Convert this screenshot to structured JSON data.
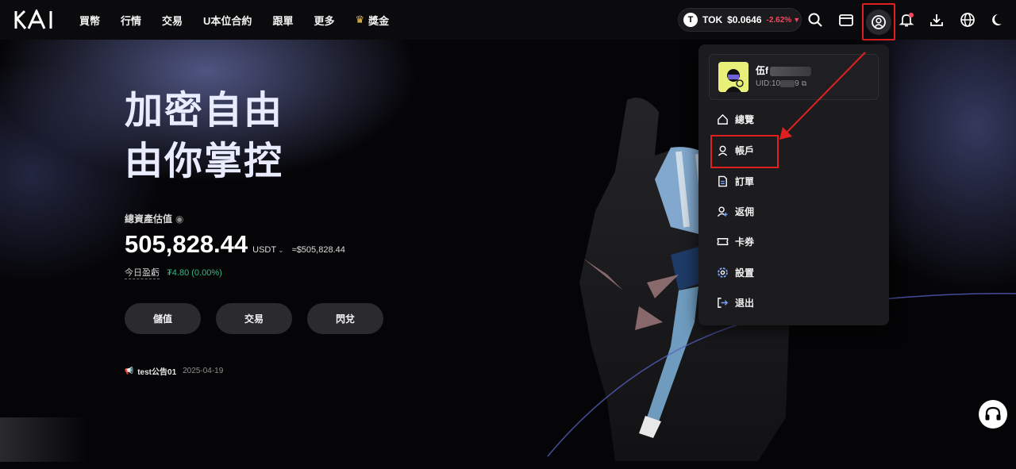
{
  "brand": {
    "logo_text": "KAI"
  },
  "nav": {
    "items": [
      {
        "label": "買幣"
      },
      {
        "label": "行情"
      },
      {
        "label": "交易"
      },
      {
        "label": "U本位合約"
      },
      {
        "label": "跟單"
      },
      {
        "label": "更多"
      },
      {
        "label": "獎金",
        "icon": "crown-icon"
      }
    ]
  },
  "ticker": {
    "symbol": "TOK",
    "logo_letter": "T",
    "price": "$0.0646",
    "change": "-2.62%",
    "direction": "down"
  },
  "toolbar": {
    "icons": [
      "search-icon",
      "wallet-icon",
      "user-icon",
      "bell-icon",
      "download-icon",
      "globe-icon",
      "moon-icon"
    ]
  },
  "hero": {
    "title_line1": "加密自由",
    "title_line2": "由你掌控",
    "total_assets_label": "總資產估值",
    "total_assets_value": "505,828.44",
    "asset_unit": "USDT",
    "asset_usd": "≈$505,828.44",
    "pnl_label": "今日盈虧",
    "pnl_value": "₮4.80 (0.00%)",
    "buttons": {
      "deposit": "儲值",
      "trade": "交易",
      "convert": "閃兌"
    }
  },
  "notice": {
    "title": "test公告01",
    "date": "2025-04-19"
  },
  "user_menu": {
    "user_name": "伍f",
    "uid_prefix": "UID:10",
    "uid_suffix": "9",
    "items": [
      {
        "label": "總覽",
        "icon": "home-icon"
      },
      {
        "label": "帳戶",
        "icon": "user-icon"
      },
      {
        "label": "訂單",
        "icon": "document-icon"
      },
      {
        "label": "返佣",
        "icon": "user-plus-icon"
      },
      {
        "label": "卡券",
        "icon": "ticket-icon"
      },
      {
        "label": "設置",
        "icon": "settings-icon"
      },
      {
        "label": "退出",
        "icon": "logout-icon"
      }
    ]
  },
  "colors": {
    "accent_red": "#e02020",
    "negative": "#f6465d",
    "positive": "#2ebd85"
  }
}
